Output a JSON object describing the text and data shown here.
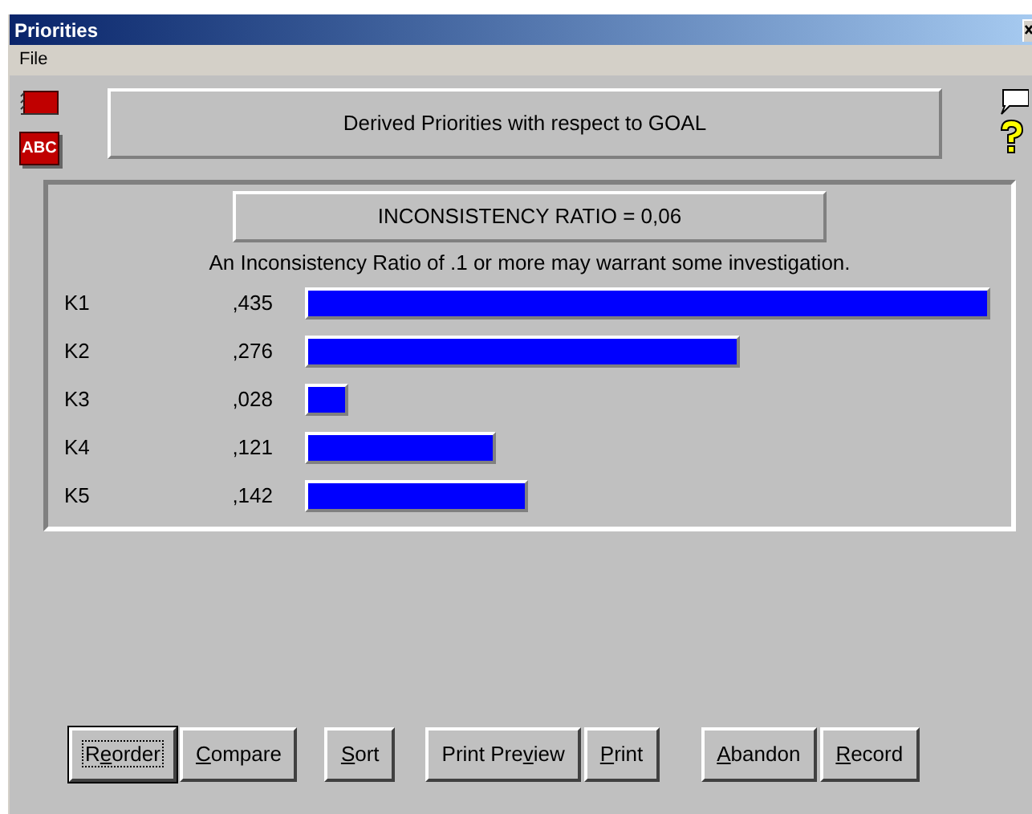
{
  "window": {
    "title": "Priorities"
  },
  "menu": [
    "File"
  ],
  "toolbar": {
    "abc_icon_label": "ABC"
  },
  "header": "Derived Priorities with respect to GOAL",
  "inconsistency": {
    "ratio": "INCONSISTENCY RATIO = 0,06",
    "note": "An Inconsistency Ratio of .1 or more may warrant some investigation."
  },
  "priorities": [
    {
      "name": "K1",
      "value": ",435"
    },
    {
      "name": "K2",
      "value": ",276"
    },
    {
      "name": "K3",
      "value": ",028"
    },
    {
      "name": "K4",
      "value": ",121"
    },
    {
      "name": "K5",
      "value": ",142"
    }
  ],
  "buttons": [
    {
      "pre": "R",
      "key": "e",
      "post": "order",
      "focused": true
    },
    {
      "key": "C",
      "post": "ompare",
      "focused": false
    },
    {
      "key": "S",
      "post": "ort",
      "focused": false
    },
    {
      "pre": "Print Pre",
      "key": "v",
      "post": "iew",
      "focused": false
    },
    {
      "key": "P",
      "post": "rint",
      "focused": false
    },
    {
      "key": "A",
      "post": "bandon",
      "focused": false
    },
    {
      "key": "R",
      "post": "ecord",
      "focused": false
    }
  ]
}
